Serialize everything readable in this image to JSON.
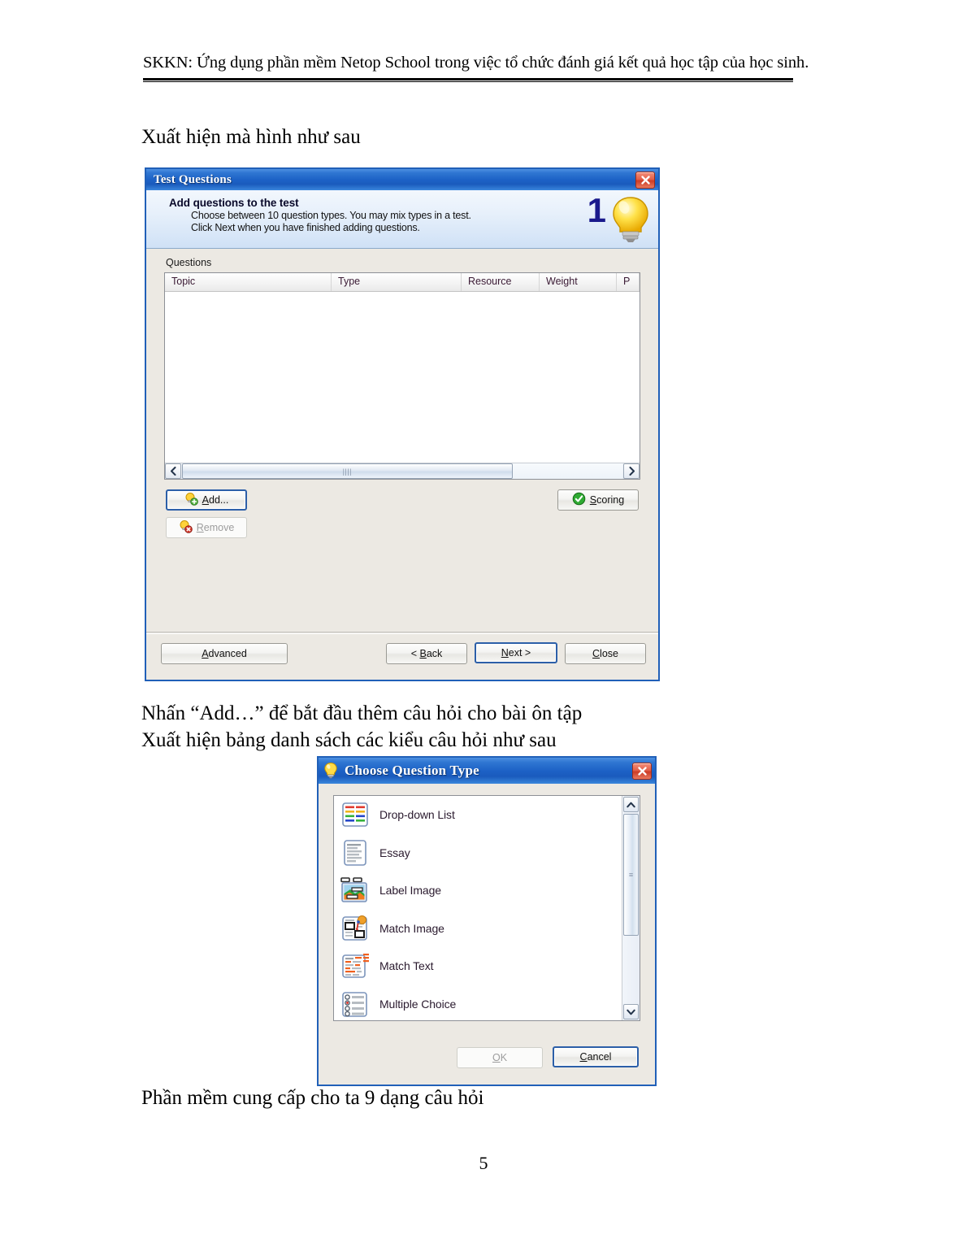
{
  "document": {
    "header": "SKKN: Ứng dụng phần mềm Netop School trong việc tổ chức đánh giá kết quả học tập của học sinh.",
    "paragraph_1": "Xuất hiện mà hình như sau",
    "paragraph_2": "Nhấn “Add…” để bắt đầu thêm câu hỏi cho bài ôn tập",
    "paragraph_3": "Xuất hiện bảng danh sách các kiểu câu hỏi như sau",
    "paragraph_4": "Phần mềm cung cấp cho ta 9 dạng câu hỏi",
    "page_number": "5"
  },
  "test_questions_dialog": {
    "title": "Test Questions",
    "close_icon": "close-icon",
    "banner": {
      "heading": "Add questions to the test",
      "line1": "Choose between 10 question types. You may mix types in a test.",
      "line2": "Click Next when you have finished adding questions.",
      "step_number": "1",
      "icon": "lightbulb-icon"
    },
    "questions_label": "Questions",
    "grid": {
      "columns": [
        "Topic",
        "Type",
        "Resource",
        "Weight",
        "P"
      ],
      "rows": []
    },
    "buttons": {
      "add": "Add...",
      "remove": "Remove",
      "scoring": "Scoring",
      "advanced": "Advanced",
      "back": "< Back",
      "next": "Next >",
      "close": "Close"
    }
  },
  "choose_question_type_dialog": {
    "title": "Choose Question Type",
    "title_icon": "lightbulb-icon",
    "close_icon": "close-icon",
    "items": [
      {
        "label": "Drop-down List",
        "icon": "drop-down-list-icon"
      },
      {
        "label": "Essay",
        "icon": "essay-icon"
      },
      {
        "label": "Label Image",
        "icon": "label-image-icon"
      },
      {
        "label": "Match Image",
        "icon": "match-image-icon"
      },
      {
        "label": "Match Text",
        "icon": "match-text-icon"
      },
      {
        "label": "Multiple Choice",
        "icon": "multiple-choice-icon"
      }
    ],
    "buttons": {
      "ok": "OK",
      "cancel": "Cancel"
    }
  },
  "colors": {
    "titlebar_blue": "#1d62c6",
    "dialog_face": "#ece9e3",
    "close_red": "#cc3c26",
    "step_number_blue": "#1a1a8c",
    "default_button_border": "#2c5fa8"
  }
}
